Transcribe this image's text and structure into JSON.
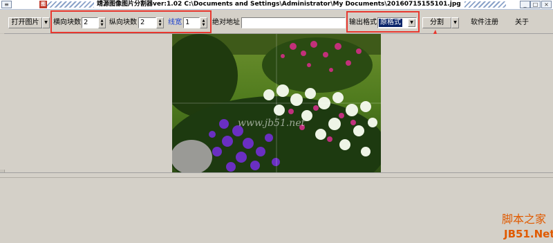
{
  "window": {
    "title": "靖源图像图片分割器ver:1.02 C:\\Documents and Settings\\Administrator\\My Documents\\20160715155101.jpg",
    "icon": "app-logo-icon"
  },
  "toolbar": {
    "open_image_label": "打开图片",
    "horizontal_blocks_label": "横向块数",
    "horizontal_blocks_value": "2",
    "vertical_blocks_label": "纵向块数",
    "vertical_blocks_value": "2",
    "line_width_label": "线宽",
    "line_width_value": "1",
    "absolute_path_label": "绝对地址",
    "absolute_path_value": "",
    "output_format_label": "输出格式",
    "output_format_value": "原格式",
    "split_label": "分割",
    "register_label": "软件注册",
    "about_label": "关于"
  },
  "preview": {
    "watermark_text": "www.jb51.net"
  },
  "site_watermark": {
    "line1": "脚本之家",
    "line2": "JB51.Net"
  },
  "colors": {
    "highlight": "#e8382f",
    "selection": "#0a246a",
    "line_width_label": "#1a3fcf",
    "window_bg": "#d4d0c8"
  }
}
